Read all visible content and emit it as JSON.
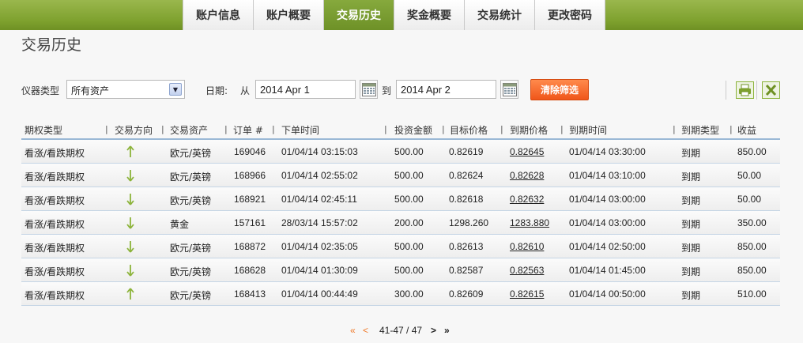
{
  "nav": {
    "tabs": [
      {
        "label": "账户信息",
        "active": false
      },
      {
        "label": "账户概要",
        "active": false
      },
      {
        "label": "交易历史",
        "active": true
      },
      {
        "label": "奖金概要",
        "active": false
      },
      {
        "label": "交易统计",
        "active": false
      },
      {
        "label": "更改密码",
        "active": false
      }
    ]
  },
  "page": {
    "title": "交易历史"
  },
  "filters": {
    "instrument_label": "仪器类型",
    "instrument_value": "所有资产",
    "date_label": "日期:",
    "from_label": "从",
    "from_value": "2014 Apr 1",
    "to_label": "到",
    "to_value": "2014 Apr 2",
    "clear_label": "清除筛选"
  },
  "toolbar": {
    "icons": [
      "print-icon",
      "excel-export-icon"
    ]
  },
  "table": {
    "columns": [
      "期权类型",
      "交易方向",
      "交易资产",
      "订单 #",
      "下单时间",
      "投资金额",
      "目标价格",
      "到期价格",
      "到期时间",
      "到期类型",
      "收益"
    ],
    "rows": [
      {
        "type": "看涨/看跌期权",
        "direction": "up",
        "asset": "欧元/英镑",
        "order": "169046",
        "time": "01/04/14 03:15:03",
        "amount": "500.00",
        "target": "0.82619",
        "expiry_price": "0.82645",
        "expiry_time": "01/04/14 03:30:00",
        "expiry_type": "到期",
        "profit": "850.00"
      },
      {
        "type": "看涨/看跌期权",
        "direction": "down",
        "asset": "欧元/英镑",
        "order": "168966",
        "time": "01/04/14 02:55:02",
        "amount": "500.00",
        "target": "0.82624",
        "expiry_price": "0.82628",
        "expiry_time": "01/04/14 03:10:00",
        "expiry_type": "到期",
        "profit": "50.00"
      },
      {
        "type": "看涨/看跌期权",
        "direction": "down",
        "asset": "欧元/英镑",
        "order": "168921",
        "time": "01/04/14 02:45:11",
        "amount": "500.00",
        "target": "0.82618",
        "expiry_price": "0.82632",
        "expiry_time": "01/04/14 03:00:00",
        "expiry_type": "到期",
        "profit": "50.00"
      },
      {
        "type": "看涨/看跌期权",
        "direction": "down",
        "asset": "黄金",
        "order": "157161",
        "time": "28/03/14 15:57:02",
        "amount": "200.00",
        "target": "1298.260",
        "expiry_price": "1283.880",
        "expiry_time": "01/04/14 03:00:00",
        "expiry_type": "到期",
        "profit": "350.00"
      },
      {
        "type": "看涨/看跌期权",
        "direction": "down",
        "asset": "欧元/英镑",
        "order": "168872",
        "time": "01/04/14 02:35:05",
        "amount": "500.00",
        "target": "0.82613",
        "expiry_price": "0.82610",
        "expiry_time": "01/04/14 02:50:00",
        "expiry_type": "到期",
        "profit": "850.00"
      },
      {
        "type": "看涨/看跌期权",
        "direction": "down",
        "asset": "欧元/英镑",
        "order": "168628",
        "time": "01/04/14 01:30:09",
        "amount": "500.00",
        "target": "0.82587",
        "expiry_price": "0.82563",
        "expiry_time": "01/04/14 01:45:00",
        "expiry_type": "到期",
        "profit": "850.00"
      },
      {
        "type": "看涨/看跌期权",
        "direction": "up",
        "asset": "欧元/英镑",
        "order": "168413",
        "time": "01/04/14 00:44:49",
        "amount": "300.00",
        "target": "0.82609",
        "expiry_price": "0.82615",
        "expiry_time": "01/04/14 00:50:00",
        "expiry_type": "到期",
        "profit": "510.00"
      }
    ]
  },
  "pagination": {
    "first": "«",
    "prev": "<",
    "range": "41-47 / 47",
    "next": ">",
    "last": "»"
  },
  "colors": {
    "accent_green": "#7ea12e",
    "button_orange": "#f0561a",
    "arrow_green": "#8cb33a"
  }
}
